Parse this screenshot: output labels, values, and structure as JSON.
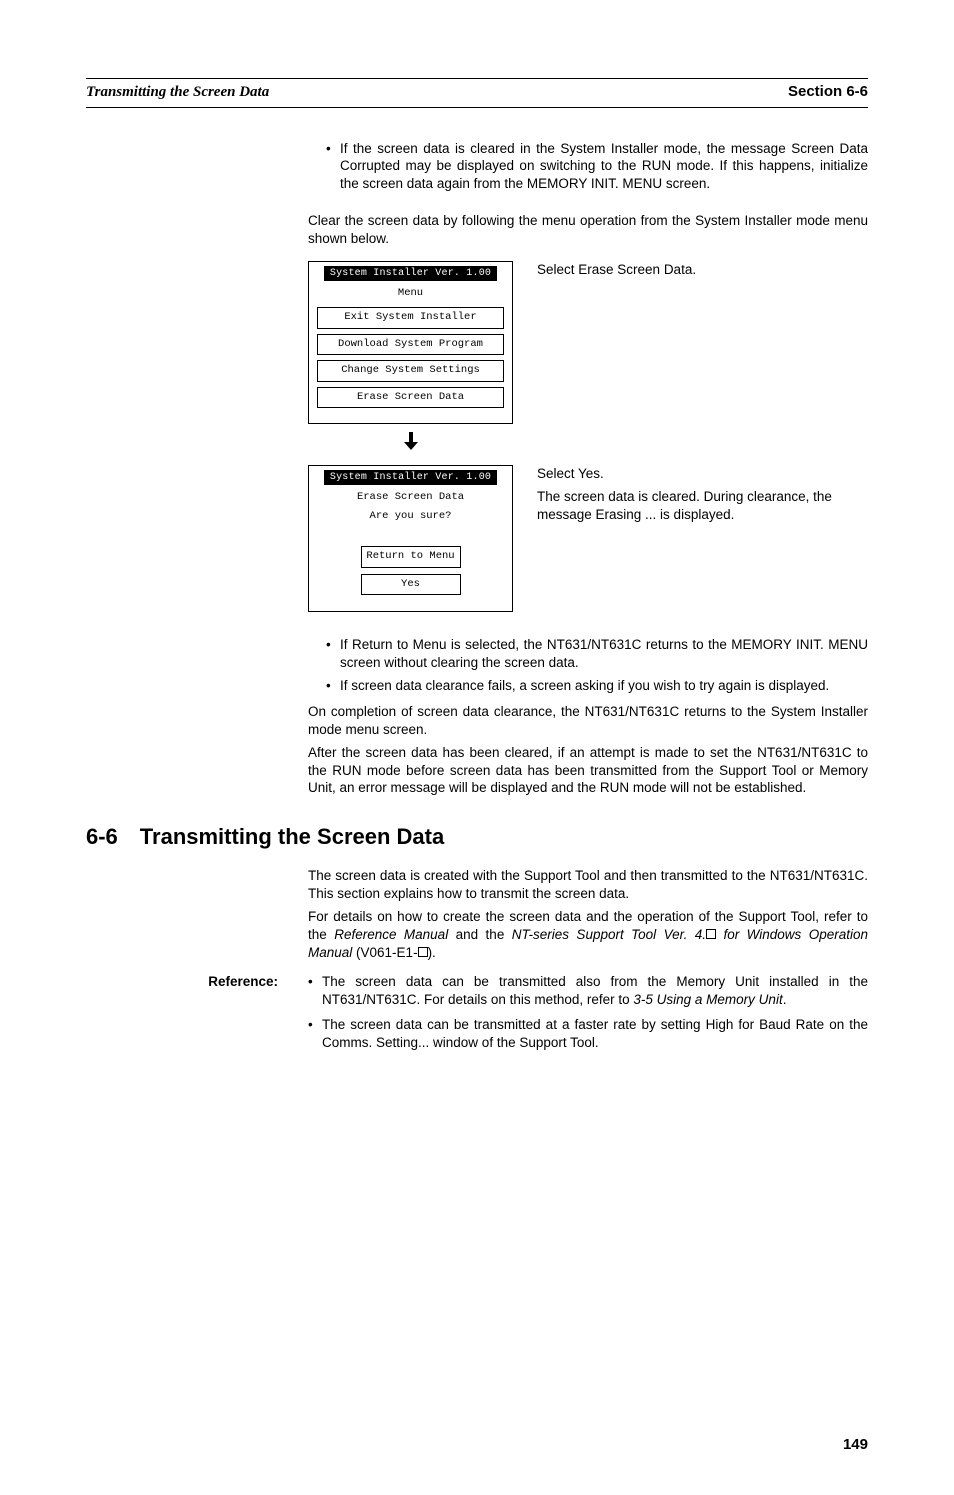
{
  "header": {
    "title_left": "Transmitting the Screen Data",
    "title_right": "Section 6-6"
  },
  "intro": {
    "bullet1": "If the screen data is cleared in the System Installer mode, the message Screen Data Corrupted may be displayed on switching to the RUN mode. If this happens, initialize the screen data again from the MEMORY INIT. MENU screen.",
    "clear_instr": "Clear the screen data by following the menu operation from the System Installer mode menu shown below."
  },
  "panel1": {
    "title": "System Installer  Ver. 1.00",
    "menu_label": "Menu",
    "btn1": "Exit System Installer",
    "btn2": "Download System Program",
    "btn3": "Change System Settings",
    "btn4": "Erase Screen Data",
    "side": "Select Erase Screen Data."
  },
  "panel2": {
    "title": "System Installer  Ver. 1.00",
    "line1": "Erase Screen Data",
    "line2": "Are you sure?",
    "btn1": "Return to Menu",
    "btn2": "Yes",
    "side1": "Select Yes.",
    "side2": "The screen data is cleared. During clearance, the message Erasing ... is displayed."
  },
  "post_bullets": {
    "b1": "If Return to Menu is selected, the NT631/NT631C returns to the MEMORY INIT. MENU screen without clearing the screen data.",
    "b2": "If screen data clearance fails, a screen asking if you wish to try again is displayed."
  },
  "post_paras": {
    "p1": "On completion of screen data clearance, the NT631/NT631C returns to the System Installer mode menu screen.",
    "p2": "After the screen data has been cleared, if an attempt is made to set the NT631/NT631C to the RUN mode before screen data has been transmitted from the Support Tool or Memory Unit, an error message will be displayed and the RUN mode will not be established."
  },
  "section": {
    "num": "6-6",
    "title": "Transmitting the Screen Data",
    "p1": "The screen data is created with the Support Tool and then transmitted to the NT631/NT631C. This section explains how to transmit the screen data.",
    "p2a": "For details on how to create the screen data and the operation of the Support Tool, refer to the ",
    "p2_ref1": "Reference Manual",
    "p2b": " and the ",
    "p2_ref2": "NT-series Support Tool Ver. 4.",
    "p2_ref3": " for Windows Operation Manual",
    "p2c": " (V061-E1-",
    "p2d": ")."
  },
  "reference": {
    "label": "Reference:",
    "b1a": "The screen data can be transmitted also from the Memory Unit installed in the NT631/NT631C. For details on this method, refer to ",
    "b1_ref": "3-5 Using a Memory Unit",
    "b1b": ".",
    "b2": "The screen data can be transmitted at a faster rate by setting High for Baud Rate on the Comms. Setting... window of the Support Tool."
  },
  "page": "149"
}
